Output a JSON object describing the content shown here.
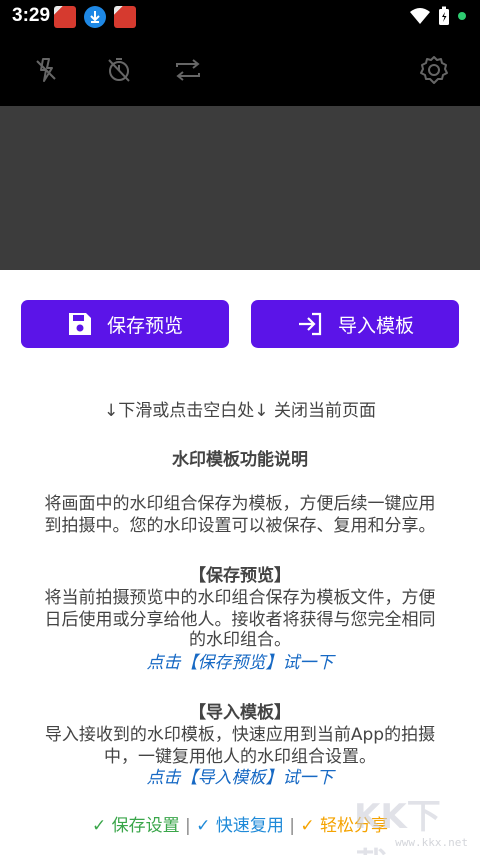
{
  "status_bar": {
    "time": "3:29"
  },
  "buttons": {
    "save_preview": "保存预览",
    "import_template": "导入模板"
  },
  "content": {
    "hint": "↓下滑或点击空白处↓ 关闭当前页面",
    "title": "水印模板功能说明",
    "intro_line1": "将画面中的水印组合保存为模板，方便后续一键应用",
    "intro_line2": "到拍摄中。您的水印设置可以被保存、复用和分享。",
    "save_heading": "【保存预览】",
    "save_line1": "将当前拍摄预览中的水印组合保存为模板文件，方便",
    "save_line2": "日后使用或分享给他人。接收者将获得与您完全相同",
    "save_line3": "的水印组合。",
    "save_link": "点击【保存预览】试一下",
    "import_heading": "【导入模板】",
    "import_line1": "导入接收到的水印模板，快速应用到当前App的拍摄",
    "import_line2": "中，一键复用他人的水印组合设置。",
    "import_link": "点击【导入模板】试一下"
  },
  "footer": {
    "item1": "✓ 保存设置",
    "sep1": " | ",
    "item2": "✓ 快速复用",
    "sep2": " | ",
    "item3": "✓ 轻松分享"
  },
  "watermark": {
    "logo": "KK下载",
    "url": "www.kkx.net"
  },
  "colors": {
    "accent": "#5b14e8",
    "link": "#1769c4",
    "green": "#3aa64a",
    "blue": "#1f8ad8",
    "orange": "#f5a300"
  }
}
